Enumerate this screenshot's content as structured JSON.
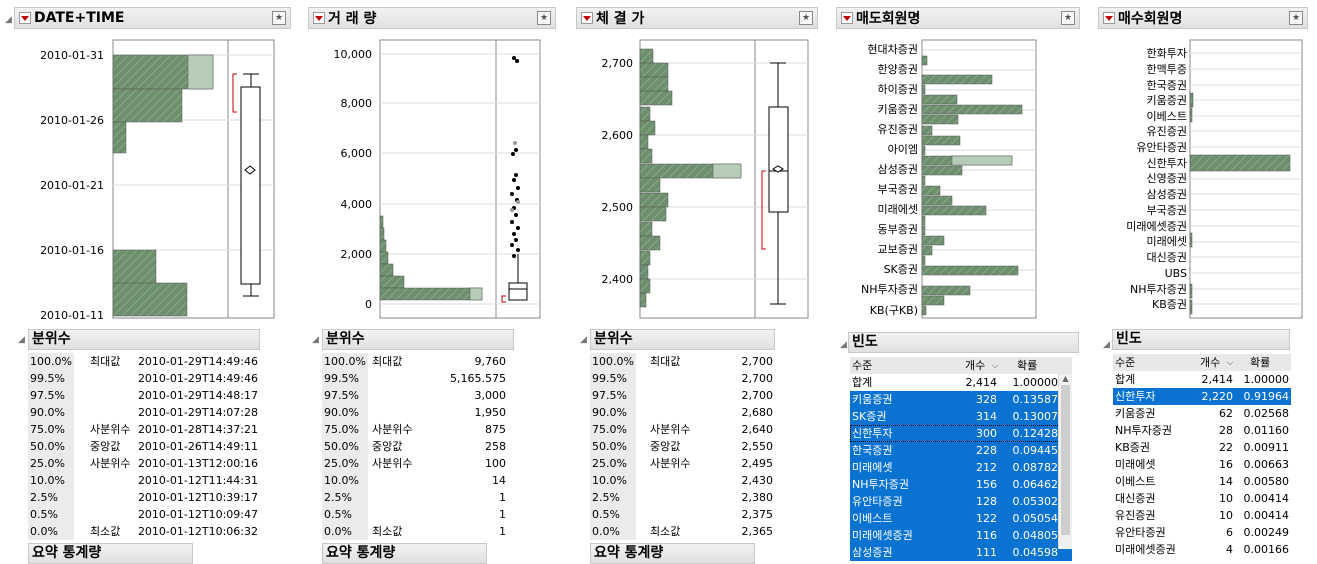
{
  "panels": [
    {
      "title": "DATE+TIME",
      "quantiles_title": "분위수",
      "y_ticks": [
        "2010-01-31",
        "2010-01-26",
        "2010-01-21",
        "2010-01-16",
        "2010-01-11"
      ],
      "quantiles": [
        [
          "100.0%",
          "최대값",
          "2010-01-29T14:49:46"
        ],
        [
          "99.5%",
          "",
          "2010-01-29T14:49:46"
        ],
        [
          "97.5%",
          "",
          "2010-01-29T14:48:17"
        ],
        [
          "90.0%",
          "",
          "2010-01-29T14:07:28"
        ],
        [
          "75.0%",
          "사분위수",
          "2010-01-28T14:37:21"
        ],
        [
          "50.0%",
          "중앙값",
          "2010-01-26T14:49:11"
        ],
        [
          "25.0%",
          "사분위수",
          "2010-01-13T12:00:16"
        ],
        [
          "10.0%",
          "",
          "2010-01-12T11:44:31"
        ],
        [
          "2.5%",
          "",
          "2010-01-12T10:39:17"
        ],
        [
          "0.5%",
          "",
          "2010-01-12T10:09:47"
        ],
        [
          "0.0%",
          "최소값",
          "2010-01-12T10:06:32"
        ]
      ],
      "more": "요약 통계량"
    },
    {
      "title": "거 래 량",
      "quantiles_title": "분위수",
      "y_ticks": [
        "10,000",
        "8,000",
        "6,000",
        "4,000",
        "2,000",
        "0"
      ],
      "quantiles": [
        [
          "100.0%",
          "최대값",
          "9,760"
        ],
        [
          "99.5%",
          "",
          "5,165.575"
        ],
        [
          "97.5%",
          "",
          "3,000"
        ],
        [
          "90.0%",
          "",
          "1,950"
        ],
        [
          "75.0%",
          "사분위수",
          "875"
        ],
        [
          "50.0%",
          "중앙값",
          "258"
        ],
        [
          "25.0%",
          "사분위수",
          "100"
        ],
        [
          "10.0%",
          "",
          "14"
        ],
        [
          "2.5%",
          "",
          "1"
        ],
        [
          "0.5%",
          "",
          "1"
        ],
        [
          "0.0%",
          "최소값",
          "1"
        ]
      ],
      "more": "요약 통계량"
    },
    {
      "title": "체 결 가",
      "quantiles_title": "분위수",
      "y_ticks": [
        "2,700",
        "2,600",
        "2,500",
        "2,400"
      ],
      "quantiles": [
        [
          "100.0%",
          "최대값",
          "2,700"
        ],
        [
          "99.5%",
          "",
          "2,700"
        ],
        [
          "97.5%",
          "",
          "2,700"
        ],
        [
          "90.0%",
          "",
          "2,680"
        ],
        [
          "75.0%",
          "사분위수",
          "2,640"
        ],
        [
          "50.0%",
          "중앙값",
          "2,550"
        ],
        [
          "25.0%",
          "사분위수",
          "2,495"
        ],
        [
          "10.0%",
          "",
          "2,430"
        ],
        [
          "2.5%",
          "",
          "2,380"
        ],
        [
          "0.5%",
          "",
          "2,375"
        ],
        [
          "0.0%",
          "최소값",
          "2,365"
        ]
      ],
      "more": "요약 통계량"
    },
    {
      "title": "매도회원명",
      "freq_title": "빈도",
      "labels": [
        "현대차증권",
        "한양증권",
        "하이증권",
        "키움증권",
        "유진증권",
        "아이엠",
        "삼성증권",
        "부국증권",
        "미래에셋",
        "동부증권",
        "교보증권",
        "SK증권",
        "NH투자증권",
        "KB(구KB)"
      ],
      "freq_header": [
        "수준",
        "개수",
        "확률"
      ],
      "freq_rows": [
        [
          "합계",
          "2,414",
          "1.00000"
        ],
        [
          "키움증권",
          "328",
          "0.13587"
        ],
        [
          "SK증권",
          "314",
          "0.13007"
        ],
        [
          "신한투자",
          "300",
          "0.12428"
        ],
        [
          "한국증권",
          "228",
          "0.09445"
        ],
        [
          "미래에셋",
          "212",
          "0.08782"
        ],
        [
          "NH투자증권",
          "156",
          "0.06462"
        ],
        [
          "유안타증권",
          "128",
          "0.05302"
        ],
        [
          "이베스트",
          "122",
          "0.05054"
        ],
        [
          "미래에셋증권",
          "116",
          "0.04805"
        ],
        [
          "삼성증권",
          "111",
          "0.04598"
        ]
      ]
    },
    {
      "title": "매수회원명",
      "freq_title": "빈도",
      "labels": [
        "한화투자",
        "한맥투증",
        "한국증권",
        "키움증권",
        "이베스트",
        "유진증권",
        "유안타증권",
        "신한투자",
        "신영증권",
        "삼성증권",
        "부국증권",
        "미래에셋증권",
        "미래에셋",
        "대신증권",
        "UBS",
        "NH투자증권",
        "KB증권"
      ],
      "freq_header": [
        "수준",
        "개수",
        "확률"
      ],
      "freq_rows": [
        [
          "합계",
          "2,414",
          "1.00000"
        ],
        [
          "신한투자",
          "2,220",
          "0.91964"
        ],
        [
          "키움증권",
          "62",
          "0.02568"
        ],
        [
          "NH투자증권",
          "28",
          "0.01160"
        ],
        [
          "KB증권",
          "22",
          "0.00911"
        ],
        [
          "미래에셋",
          "16",
          "0.00663"
        ],
        [
          "이베스트",
          "14",
          "0.00580"
        ],
        [
          "대신증권",
          "10",
          "0.00414"
        ],
        [
          "유진증권",
          "10",
          "0.00414"
        ],
        [
          "유안타증권",
          "6",
          "0.00249"
        ],
        [
          "미래에셋증권",
          "4",
          "0.00166"
        ]
      ]
    }
  ],
  "colors": {
    "bar": "#6e8f6e",
    "selected": "#b6ccb6",
    "accent": "#c00000",
    "select_row": "#0a72d1",
    "header": "#e6e6e6"
  }
}
